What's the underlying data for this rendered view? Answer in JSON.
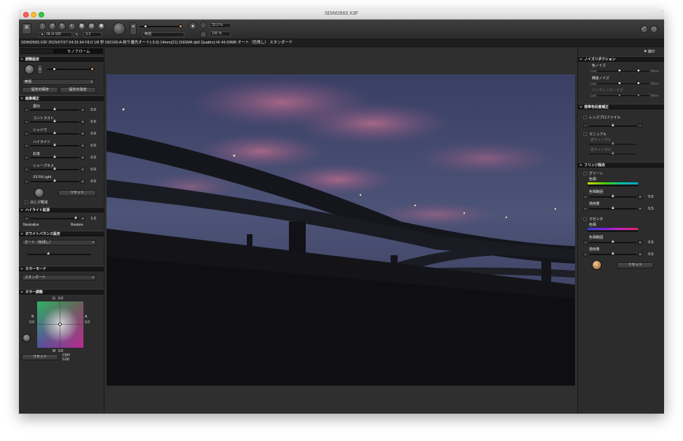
{
  "window": {
    "title": "SDIM2683.X3F"
  },
  "toolbar": {
    "counter": "68 of 189",
    "zoom_select": "3-2",
    "preset_select": "無題",
    "field_a": "25.0 %",
    "field_b": "100 %"
  },
  "info_bar": {
    "text": "SDIM2683.X3F 2015/07/27 04:31:54 F8.0 1/8 秒 ISO100 A-絞り優先オート(-3.0) 14mm(21) (SIGMA dp0 Quattro) HI 44.03MB オート（色残し） スタンダード"
  },
  "left": {
    "tabs": [
      "",
      "モノクローム"
    ],
    "adjust": {
      "header": "調整設定",
      "preset_value": "無題",
      "save_label": "設定の保存",
      "delete_label": "設定の消去"
    },
    "image_correction": {
      "header": "画像補正",
      "sliders": [
        {
          "label": "露出",
          "value": "0.0"
        },
        {
          "label": "コントラスト",
          "value": "0.0"
        },
        {
          "label": "シャドウ",
          "value": "0.0"
        },
        {
          "label": "ハイライト",
          "value": "0.0"
        },
        {
          "label": "彩度",
          "value": "0.0"
        },
        {
          "label": "シャープネス",
          "value": "0.0"
        },
        {
          "label": "X3 Fill Light",
          "value": "0.0"
        }
      ],
      "reset_label": "リセット",
      "clip_label": "白とび軽減"
    },
    "highlight": {
      "header": "ハイライト拡張",
      "value": "1.0",
      "left_label": "Neutralize",
      "right_label": "Restore"
    },
    "white_balance": {
      "header": "ホワイトバランス設定",
      "value": "オート（色残し）"
    },
    "color_mode": {
      "header": "カラーモード",
      "value": "スタンダード"
    },
    "color_adjust": {
      "header": "カラー調整",
      "g_label": "G",
      "g_value": "0.0",
      "b_label": "B",
      "b_value": "0.0",
      "a_label": "A",
      "a_value": "0.0",
      "m_label": "M",
      "m_value": "0.0",
      "reset_label": "リセット",
      "cmy_label": "CMY",
      "cmy_value": "0.00"
    }
  },
  "right": {
    "top_label": "⚑ 旗印",
    "noise": {
      "header": "ノイズリダクション",
      "color_noise": "色ノイズ",
      "lum_noise": "輝度ノイズ",
      "banding_noise": "バンディングノイズ",
      "low": "Low",
      "more": "More"
    },
    "lens": {
      "header": "倍率色収差補正",
      "profile_label": "レンズプロファイル",
      "manual_label": "マニュアル",
      "red_label": "赤チャンネル",
      "blue_label": "青チャンネル"
    },
    "fringe": {
      "header": "フリンジ除去",
      "green_label": "グリーン",
      "hue_label": "色相",
      "hue_range_label": "色相範囲",
      "amount_label": "適用量",
      "green_range_value": "0.5",
      "green_amount_value": "0.5",
      "magenta_label": "マゼンタ",
      "magenta_range_value": "0.5",
      "magenta_amount_value": "0.5",
      "reset_label": "リセット"
    }
  },
  "colors": {
    "accent_orange": "#e8a060",
    "panel_bg": "#2c2c2c",
    "header_bg": "#181818"
  }
}
